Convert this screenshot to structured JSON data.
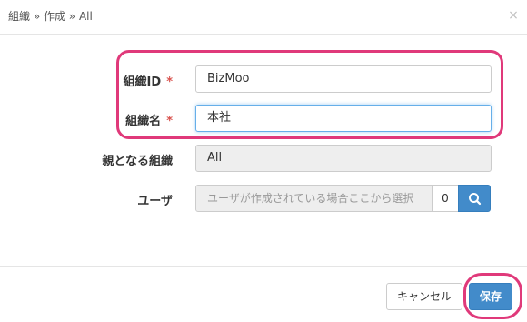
{
  "header": {
    "breadcrumb": "組織 » 作成 » All",
    "close_glyph": "×"
  },
  "form": {
    "org_id": {
      "label": "組織ID",
      "required_mark": "*",
      "value": "BizMoo"
    },
    "org_name": {
      "label": "組織名",
      "required_mark": "*",
      "value": "本社"
    },
    "parent_org": {
      "label": "親となる組織",
      "value": "All"
    },
    "user": {
      "label": "ユーザ",
      "placeholder": "ユーザが作成されている場合ここから選択",
      "count": "0",
      "search_icon": "search-icon"
    }
  },
  "footer": {
    "cancel_label": "キャンセル",
    "save_label": "保存"
  },
  "colors": {
    "primary": "#428bca",
    "required": "#d9534f",
    "highlight": "#e0397a"
  }
}
